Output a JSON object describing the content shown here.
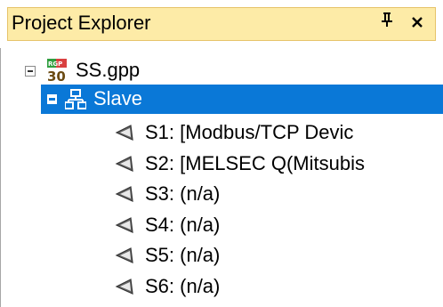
{
  "panel": {
    "title": "Project Explorer",
    "pin_icon": "pin-icon",
    "pin_glyph": "ᵽ",
    "close_glyph": "×"
  },
  "tree": {
    "root": {
      "label": "SS.gpp",
      "icon": "rgp-30-file-icon",
      "icon_text_top": "RGP",
      "icon_text_bottom": "30",
      "expanded": true
    },
    "slave": {
      "label": "Slave",
      "icon": "network-icon",
      "expanded": true,
      "selected": true
    },
    "devices": [
      {
        "label": "S1: [Modbus/TCP Devic",
        "icon": "device-icon"
      },
      {
        "label": "S2: [MELSEC Q(Mitsubis",
        "icon": "device-icon"
      },
      {
        "label": "S3: (n/a)",
        "icon": "device-icon"
      },
      {
        "label": "S4: (n/a)",
        "icon": "device-icon"
      },
      {
        "label": "S5: (n/a)",
        "icon": "device-icon"
      },
      {
        "label": "S6: (n/a)",
        "icon": "device-icon"
      }
    ]
  },
  "colors": {
    "title_bg": "#fdeba7",
    "selection_bg": "#0a78d7",
    "selection_text": "#ffffff"
  }
}
